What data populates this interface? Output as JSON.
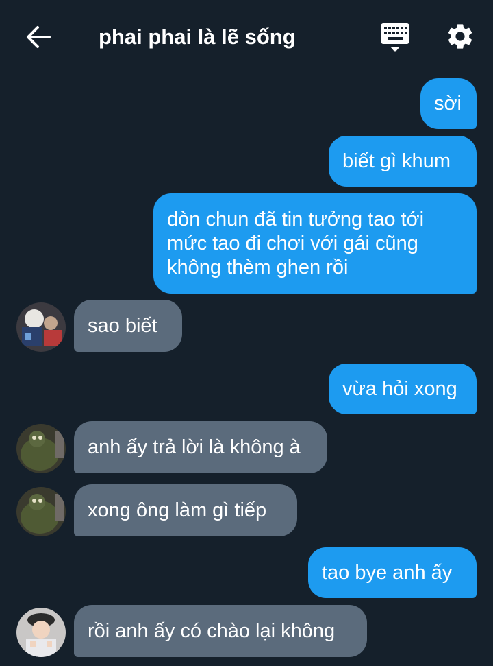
{
  "header": {
    "title": "phai phai là lẽ sống",
    "back_icon": "arrow-left-icon",
    "keyboard_icon": "keyboard-icon",
    "settings_icon": "gear-icon"
  },
  "colors": {
    "background": "#15202b",
    "outgoing_bubble": "#1d9bf0",
    "incoming_bubble": "#5b6b7c",
    "text": "#ffffff"
  },
  "messages": [
    {
      "direction": "out",
      "text": "sời"
    },
    {
      "direction": "out",
      "text": "biết gì khum"
    },
    {
      "direction": "out",
      "lines": [
        "dòn chun đã tin tưởng tao tới",
        "mức tao đi chơi với gái cũng",
        "không thèm ghen rồi"
      ]
    },
    {
      "direction": "in",
      "text": "sao biết",
      "avatar": "avatar-1"
    },
    {
      "direction": "out",
      "text": "vừa hỏi xong"
    },
    {
      "direction": "in",
      "text": "anh ấy trả lời là không à",
      "avatar": "avatar-2"
    },
    {
      "direction": "in",
      "text": "xong ông làm gì tiếp",
      "avatar": "avatar-2"
    },
    {
      "direction": "out",
      "text": "tao bye anh ấy"
    },
    {
      "direction": "in",
      "text": "rồi anh ấy có chào lại không",
      "avatar": "avatar-3"
    }
  ]
}
